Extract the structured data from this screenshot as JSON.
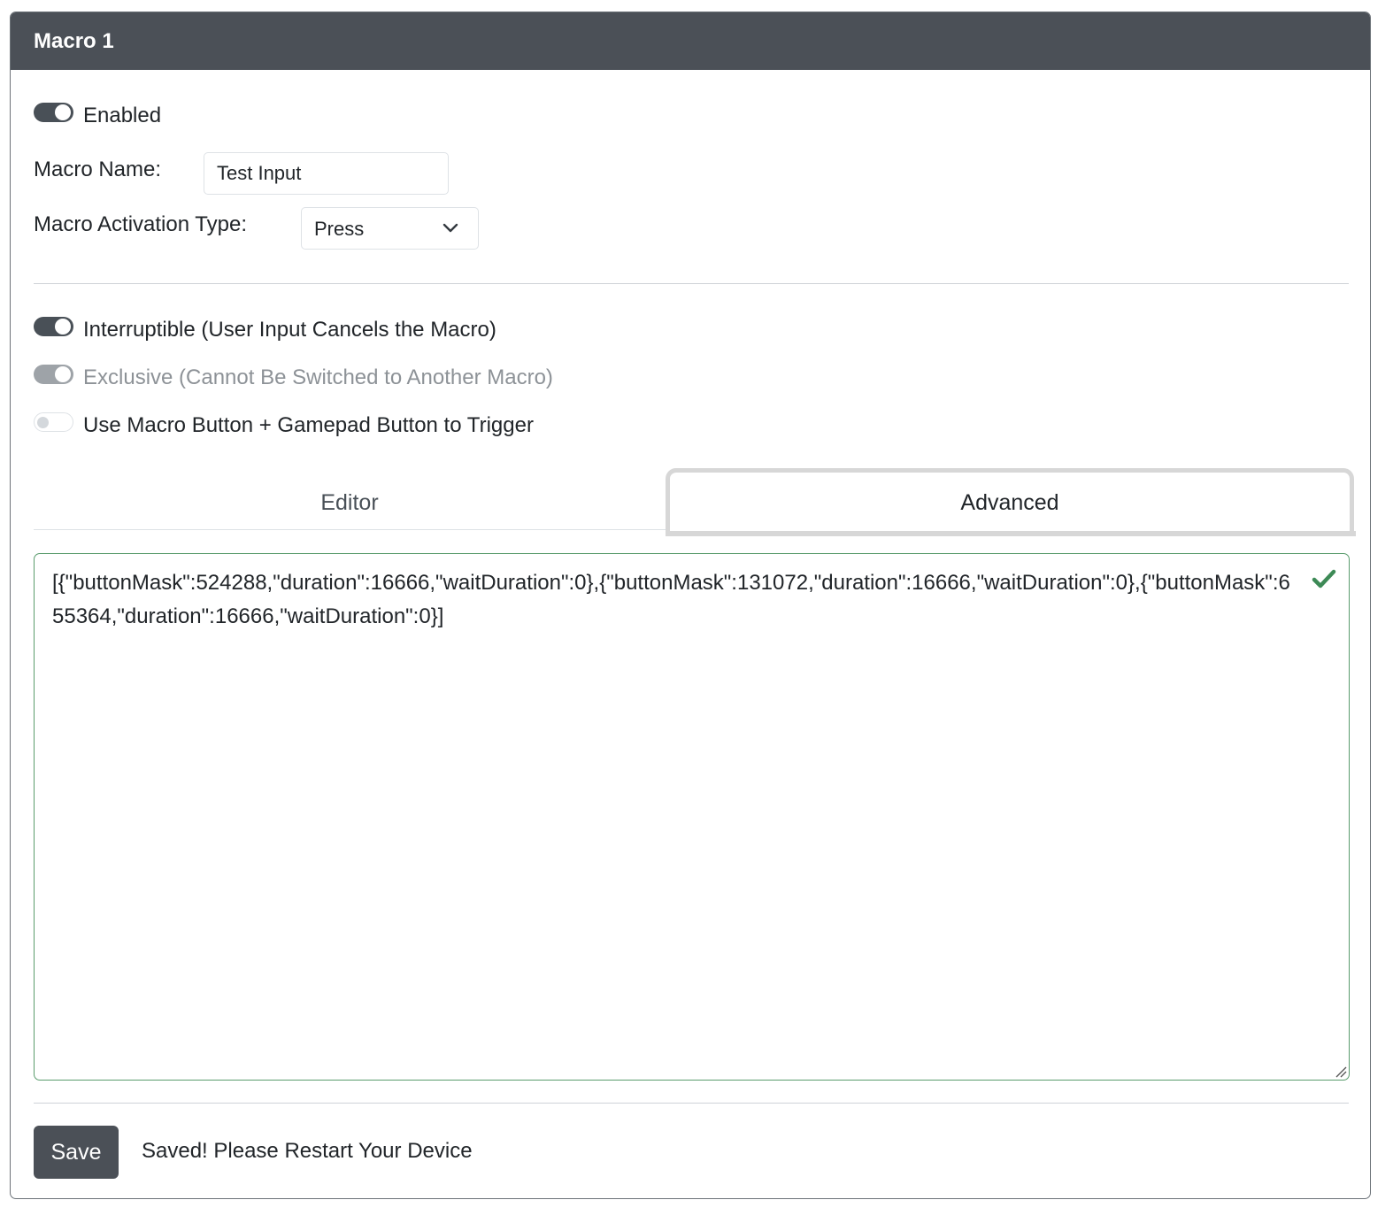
{
  "card": {
    "title": "Macro 1"
  },
  "enabled": {
    "label": "Enabled",
    "state": "on"
  },
  "macro_name": {
    "label": "Macro Name:",
    "value": "Test Input"
  },
  "activation": {
    "label": "Macro Activation Type:",
    "selected": "Press"
  },
  "options": {
    "interruptible": {
      "label": "Interruptible (User Input Cancels the Macro)",
      "state": "on"
    },
    "exclusive": {
      "label": "Exclusive (Cannot Be Switched to Another Macro)",
      "state": "on-disabled"
    },
    "combo_trigger": {
      "label": "Use Macro Button + Gamepad Button to Trigger",
      "state": "off"
    }
  },
  "tabs": [
    {
      "label": "Editor",
      "active": false
    },
    {
      "label": "Advanced",
      "active": true
    }
  ],
  "advanced": {
    "json_text": "[{\"buttonMask\":524288,\"duration\":16666,\"waitDuration\":0},{\"buttonMask\":131072,\"duration\":16666,\"waitDuration\":0},{\"buttonMask\":655364,\"duration\":16666,\"waitDuration\":0}]",
    "valid_icon": "check-icon",
    "valid_color": "#3d8a56"
  },
  "footer": {
    "save_label": "Save",
    "status": "Saved! Please Restart Your Device"
  }
}
